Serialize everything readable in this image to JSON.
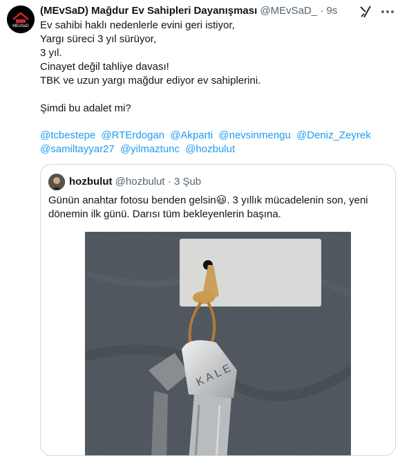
{
  "tweet": {
    "author_name": "(MEvSaD) Mağdur Ev Sahipleri Dayanışması",
    "author_handle": "@MEvSaD_",
    "separator": "·",
    "time": "9s",
    "avatar_text": "MEvSaD",
    "lines": [
      "Ev sahibi haklı nedenlerle evini geri istiyor,",
      "Yargı süreci 3 yıl sürüyor,",
      "3 yıl.",
      "Cinayet değil tahliye davası!",
      "TBK ve uzun yargı mağdur ediyor ev sahiplerini.",
      "",
      "Şimdi bu adalet mi?"
    ],
    "mentions": [
      "@tcbestepe",
      "@RTErdogan",
      "@Akparti",
      "@nevsinmengu",
      "@Deniz_Zeyrek",
      "@samiltayyar27",
      "@yilmaztunc",
      "@hozbulut"
    ]
  },
  "quote": {
    "author_name": "hozbulut",
    "author_handle": "@hozbulut",
    "separator": "·",
    "time": "3 Şub",
    "text_line1_a": "Günün anahtar fotosu benden gelsin",
    "emoji": "😃",
    "text_line1_b": ". 3 yıllık mücadelenin son, yeni",
    "text_line2": "dönemin ilk günü. Darısı tüm bekleyenlerin başına.",
    "image_brand_text": "KALE"
  },
  "icons": [
    "grok-icon",
    "more-icon"
  ],
  "colors": {
    "link": "#1d9bf0",
    "muted": "#536471",
    "border": "#cfd9de",
    "text": "#0f1419"
  }
}
